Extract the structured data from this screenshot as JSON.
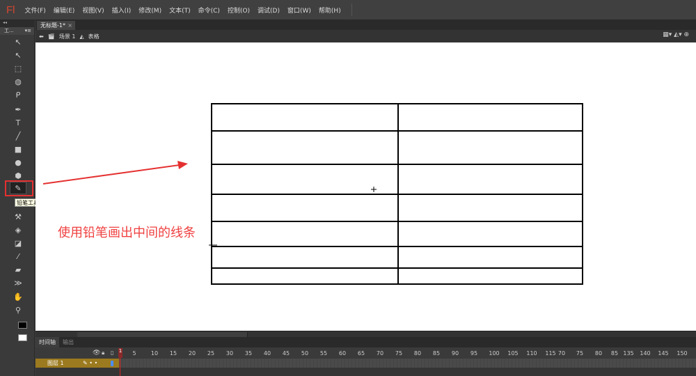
{
  "app": {
    "logo": "Fl"
  },
  "menu": [
    "文件(F)",
    "编辑(E)",
    "视图(V)",
    "插入(I)",
    "修改(M)",
    "文本(T)",
    "命令(C)",
    "控制(O)",
    "调试(D)",
    "窗口(W)",
    "帮助(H)"
  ],
  "tools_panel": {
    "title": "工..."
  },
  "tools": [
    "selection",
    "subselection",
    "free-transform",
    "3d-rotation",
    "lasso",
    "pen",
    "text",
    "line",
    "rectangle",
    "oval",
    "polystar",
    "pencil",
    "bone",
    "paint-bucket",
    "ink-bottle",
    "eyedropper",
    "eraser",
    "width",
    "hand",
    "zoom"
  ],
  "tooltip": "铅笔工具(Y)",
  "document": {
    "tab": "无标题-1*",
    "close": "×",
    "scene": "场景 1",
    "symbol": "表格"
  },
  "annotation": "使用铅笔画出中间的线条",
  "colors": {
    "accent": "#e53030",
    "layer": "#9c7a1f",
    "stroke": "#000000"
  },
  "timeline": {
    "tabs": [
      "时间轴",
      "输出"
    ],
    "layer_name": "图层 1",
    "playhead": "1",
    "ruler": [
      "5",
      "10",
      "15",
      "20",
      "25",
      "30",
      "35",
      "40",
      "45",
      "50",
      "55",
      "60",
      "65",
      "70",
      "75",
      "80",
      "85",
      "90",
      "95",
      "100",
      "105",
      "110",
      "115",
      "70",
      "75",
      "80",
      "85",
      "135",
      "140",
      "145",
      "150"
    ]
  }
}
